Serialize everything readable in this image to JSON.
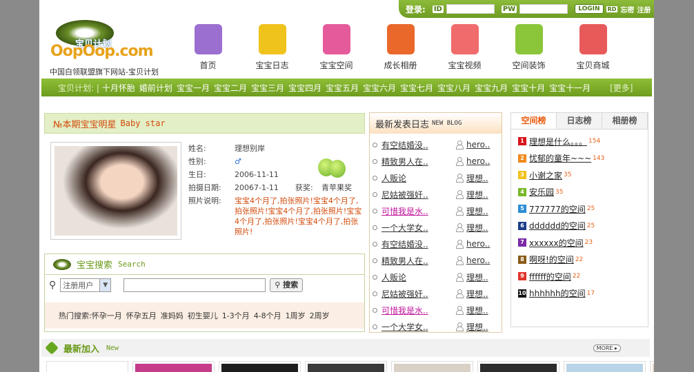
{
  "header": {
    "login_label": "登录:",
    "id_label": "ID",
    "pw_label": "PW",
    "login_button": "LOGIN",
    "rd_label": "RD",
    "forgot_label": "忘密",
    "register_label": "注册",
    "logo_text": "宝贝计划",
    "logo_brand": "OopOop.com",
    "logo_subtitle": "中国白领联盟旗下网站-宝贝计划"
  },
  "nav": [
    {
      "label": "首页",
      "icon": "books-icon",
      "color": "#9b6fd0"
    },
    {
      "label": "宝宝日志",
      "icon": "notebook-icon",
      "color": "#f0c21c"
    },
    {
      "label": "宝宝空间",
      "icon": "house-icon",
      "color": "#e55a9a"
    },
    {
      "label": "成长相册",
      "icon": "album-icon",
      "color": "#e9682a"
    },
    {
      "label": "宝宝视频",
      "icon": "castle-icon",
      "color": "#f06b6b"
    },
    {
      "label": "空间装饰",
      "icon": "music-note-icon",
      "color": "#8bc63a"
    },
    {
      "label": "宝贝商城",
      "icon": "shop-castle-icon",
      "color": "#e85a5a"
    }
  ],
  "channel_bar": {
    "prefix": "宝贝计划: |",
    "items": [
      "十月怀胎",
      "婚前计划",
      "宝宝一月",
      "宝宝二月",
      "宝宝三月",
      "宝宝四月",
      "宝宝五月",
      "宝宝六月",
      "宝宝七月",
      "宝宝八月",
      "宝宝九月",
      "宝宝十月",
      "宝宝十一月"
    ],
    "more": "[更多]"
  },
  "star": {
    "title": "№本期宝宝明星",
    "title_en": "Baby star",
    "name_label": "姓名:",
    "name": "理想别岸",
    "gender_label": "性别:",
    "gender": "♂",
    "birthday_label": "生日:",
    "birthday": "2006-11-11",
    "photo_date_label": "拍摄日期:",
    "photo_date": "20067-1-11",
    "award_label": "获奖:",
    "award": "青苹果奖",
    "desc_label": "照片说明:",
    "desc": "宝宝4个月了,拍张照片!宝宝4个月了,拍张照片!宝宝4个月了,拍张照片!宝宝4个月了,拍张照片!宝宝4个月了,拍张照片!"
  },
  "search": {
    "title": "宝宝搜索",
    "title_en": "Search",
    "select_value": "注册用户",
    "button": "搜索",
    "hot_label": "热门搜索:",
    "hot": [
      "怀孕一月",
      "怀孕五月",
      "准妈妈",
      "初生婴儿",
      "1-3个月",
      "4-8个月",
      "1周岁",
      "2周岁"
    ]
  },
  "blog": {
    "title": "最新发表日志",
    "title_en": "NEW BLOG",
    "rows": [
      {
        "title": "有空结婚没..",
        "author": "hero..",
        "hot": false
      },
      {
        "title": "精致男人在..",
        "author": "hero..",
        "hot": false
      },
      {
        "title": "人贩论",
        "author": "理想..",
        "hot": false
      },
      {
        "title": "尼姑被强奸..",
        "author": "理想..",
        "hot": false
      },
      {
        "title": "可惜我是水..",
        "author": "理想..",
        "hot": true
      },
      {
        "title": "一个大学女..",
        "author": "理想..",
        "hot": false
      },
      {
        "title": "有空结婚没..",
        "author": "hero..",
        "hot": false
      },
      {
        "title": "精致男人在..",
        "author": "hero..",
        "hot": false
      },
      {
        "title": "人贩论",
        "author": "理想..",
        "hot": false
      },
      {
        "title": "尼姑被强奸..",
        "author": "理想..",
        "hot": false
      },
      {
        "title": "可惜我是水..",
        "author": "理想..",
        "hot": true
      },
      {
        "title": "一个大学女..",
        "author": "理想..",
        "hot": false
      }
    ]
  },
  "rank": {
    "tabs": [
      "空间榜",
      "日志榜",
      "相册榜"
    ],
    "rows": [
      {
        "n": "1",
        "title": "理想是什么。。。",
        "count": "154",
        "color": "#d8141b"
      },
      {
        "n": "2",
        "title": "忧郁的童年~~~",
        "count": "143",
        "color": "#f08a1c"
      },
      {
        "n": "3",
        "title": "小谢之家",
        "count": "35",
        "color": "#f2c21b"
      },
      {
        "n": "4",
        "title": "安乐园",
        "count": "35",
        "color": "#78b829"
      },
      {
        "n": "5",
        "title": "777777的空间",
        "count": "25",
        "color": "#2b8ed6"
      },
      {
        "n": "6",
        "title": "dddddd的空间",
        "count": "25",
        "color": "#1d3c8a"
      },
      {
        "n": "7",
        "title": "xxxxxx的空间",
        "count": "23",
        "color": "#7a2aa6"
      },
      {
        "n": "8",
        "title": "啊呀!的空间",
        "count": "22",
        "color": "#8a5a18"
      },
      {
        "n": "9",
        "title": "ffffff的空间",
        "count": "22",
        "color": "#e0352a"
      },
      {
        "n": "10",
        "title": "hhhhhh的空间",
        "count": "17",
        "color": "#111111"
      }
    ]
  },
  "newest": {
    "title": "最新加入",
    "title_en": "New",
    "more": "MORE ▸"
  },
  "thumb_colors": [
    "#ffffff",
    "#c43c8a",
    "#1d1d1d",
    "#3a3a3a",
    "#d9d0c6",
    "#2c2c2c",
    "#b9d4e6",
    "#e9d6c4"
  ]
}
